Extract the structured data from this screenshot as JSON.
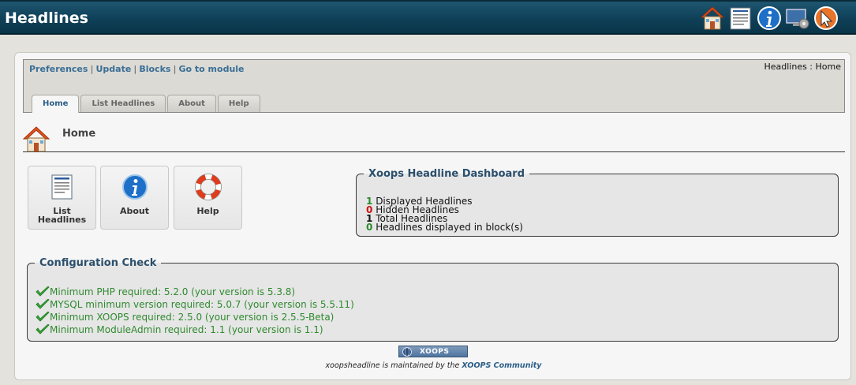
{
  "header": {
    "title": "Headlines",
    "icons": [
      "home-icon",
      "document-icon",
      "info-icon",
      "monitor-settings-icon",
      "cursor-icon"
    ]
  },
  "menu": {
    "links": [
      "Preferences",
      "Update",
      "Blocks",
      "Go to module"
    ],
    "separator": "|",
    "breadcrumb": "Headlines : Home"
  },
  "tabs": [
    {
      "label": "Home",
      "active": true
    },
    {
      "label": "List Headlines",
      "active": false
    },
    {
      "label": "About",
      "active": false
    },
    {
      "label": "Help",
      "active": false
    }
  ],
  "page": {
    "title": "Home"
  },
  "buttons": [
    {
      "label_line1": "List",
      "label_line2": "Headlines",
      "icon": "document-icon"
    },
    {
      "label_line1": "About",
      "label_line2": "",
      "icon": "info-icon"
    },
    {
      "label_line1": "Help",
      "label_line2": "",
      "icon": "lifebuoy-icon"
    }
  ],
  "dashboard": {
    "legend": "Xoops Headline Dashboard",
    "rows": [
      {
        "count": "1",
        "text": "Displayed Headlines",
        "color": "#2b8a2b"
      },
      {
        "count": "0",
        "text": "Hidden Headlines",
        "color": "#cc1111"
      },
      {
        "count": "1",
        "text": "Total Headlines",
        "color": "#111111"
      },
      {
        "count": "0",
        "text": "Headlines displayed in block(s)",
        "color": "#2b8a2b"
      }
    ]
  },
  "config": {
    "legend": "Configuration Check",
    "rows": [
      "Minimum PHP required: 5.2.0 (your version is 5.3.8)",
      "MYSQL minimum version required: 5.0.7 (your version is 5.5.11)",
      "Minimum XOOPS required: 2.5.0 (your version is 2.5.5-Beta)",
      "Minimum ModuleAdmin required: 1.1 (your version is 1.1)"
    ]
  },
  "footer": {
    "badge": "XOOPS",
    "maintained_prefix": "xoopsheadline is maintained by the",
    "community_link": "XOOPS Community"
  },
  "colors": {
    "header_bg": "#0f4058",
    "link": "#3a6e96",
    "legend": "#2b4f6c",
    "ok_green": "#2f8a2f"
  }
}
